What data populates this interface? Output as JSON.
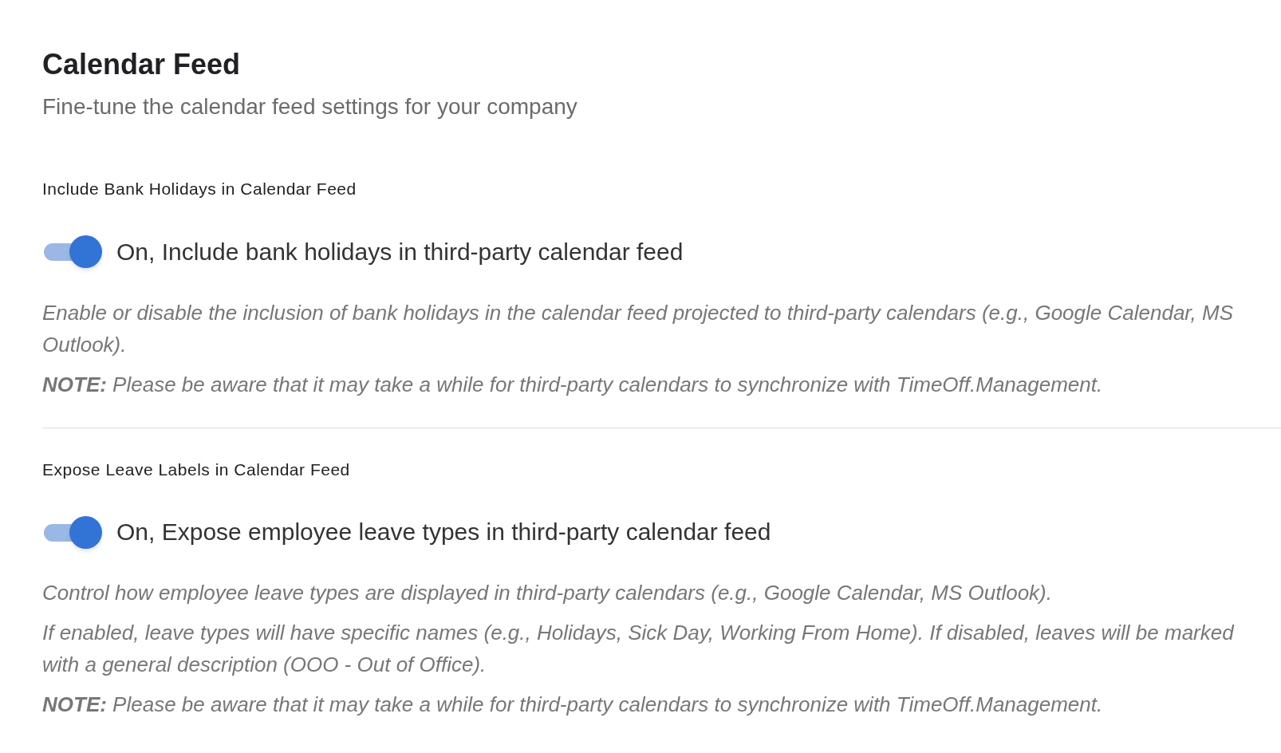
{
  "header": {
    "title": "Calendar Feed",
    "subtitle": "Fine-tune the calendar feed settings for your company"
  },
  "sections": [
    {
      "label": "Include Bank Holidays in Calendar Feed",
      "toggle": {
        "on": true,
        "label": "On, Include bank holidays in third-party calendar feed"
      },
      "notes": [
        "Enable or disable the inclusion of bank holidays in the calendar feed projected to third-party calendars (e.g., Google Calendar, MS Outlook).",
        "**NOTE:** Please be aware that it may take a while for third-party calendars to synchronize with TimeOff.Management."
      ]
    },
    {
      "label": "Expose Leave Labels in Calendar Feed",
      "toggle": {
        "on": true,
        "label": "On, Expose employee leave types in third-party calendar feed"
      },
      "notes": [
        "Control how employee leave types are displayed in third-party calendars (e.g., Google Calendar, MS Outlook).",
        "If enabled, leave types will have specific names (e.g., Holidays, Sick Day, Working From Home). If disabled, leaves will be marked with a general description (OOO - Out of Office).",
        "**NOTE:** Please be aware that it may take a while for third-party calendars to synchronize with TimeOff.Management."
      ]
    }
  ]
}
